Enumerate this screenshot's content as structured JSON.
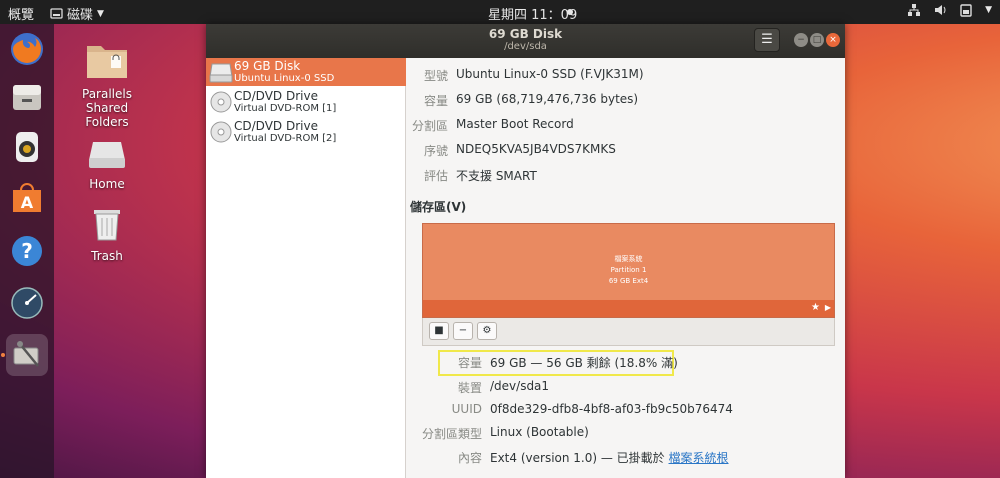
{
  "topbar": {
    "activities": "概覽",
    "app_menu": "磁碟",
    "clock": "星期四 11：09"
  },
  "desktop": {
    "icons": [
      {
        "label": "Parallels Shared Folders"
      },
      {
        "label": "Home"
      },
      {
        "label": "Trash"
      }
    ]
  },
  "window": {
    "title": "69 GB Disk",
    "subtitle": "/dev/sda",
    "drives": [
      {
        "name": "69 GB Disk",
        "sub": "Ubuntu Linux-0 SSD"
      },
      {
        "name": "CD/DVD Drive",
        "sub": "Virtual DVD-ROM [1]"
      },
      {
        "name": "CD/DVD Drive",
        "sub": "Virtual DVD-ROM [2]"
      }
    ],
    "disk_info": {
      "model_label": "型號",
      "model": "Ubuntu Linux-0 SSD (F.VJK31M)",
      "size_label": "容量",
      "size": "69 GB (68,719,476,736 bytes)",
      "partitioning_label": "分割區",
      "partitioning": "Master Boot Record",
      "serial_label": "序號",
      "serial": "NDEQ5KVA5JB4VDS7KMKS",
      "assessment_label": "評估",
      "assessment": "不支援 SMART"
    },
    "volumes_title": "儲存區(V)",
    "volume_block": {
      "line1": "檔案系統",
      "line2": "Partition 1",
      "line3": "69 GB Ext4"
    },
    "partition_info": {
      "size_label": "容量",
      "size": "69 GB — 56 GB 剩餘 (18.8% 滿)",
      "device_label": "裝置",
      "device": "/dev/sda1",
      "uuid_label": "UUID",
      "uuid": "0f8de329-dfb8-4bf8-af03-fb9c50b76474",
      "type_label": "分割區類型",
      "type": "Linux (Bootable)",
      "contents_label": "內容",
      "contents": "Ext4 (version 1.0) — 已掛載於",
      "mount_link": "檔案系統根"
    }
  },
  "colors": {
    "accent": "#e8764a",
    "titlebar": "#3c3b37",
    "highlight": "#f0e84a"
  }
}
